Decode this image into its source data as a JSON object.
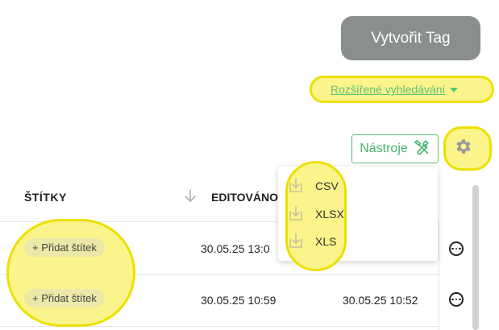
{
  "toolbar": {
    "create_tag_label": "Vytvořit Tag",
    "advanced_search_label": "Rozšířené vyhledávání",
    "tools_label": "Nástroje"
  },
  "table": {
    "columns": [
      "ŠTÍTKY",
      "EDITOVÁNO"
    ],
    "rows": [
      {
        "tag_button": "+ Přidat štítek",
        "edited": "30.05.25 13:0"
      },
      {
        "tag_button": "+ Přidat štítek",
        "edited": "30.05.25 10:59",
        "created": "30.05.25 10:52"
      }
    ]
  },
  "export_menu": {
    "items": [
      {
        "label": "CSV",
        "icon": "download-icon"
      },
      {
        "label": "XLSX",
        "icon": "download-icon"
      },
      {
        "label": "XLS",
        "icon": "download-icon"
      }
    ]
  },
  "colors": {
    "primary_button": "#8a8f8d",
    "accent_green": "#56c07a",
    "highlight_yellow": "#fbf48a"
  }
}
